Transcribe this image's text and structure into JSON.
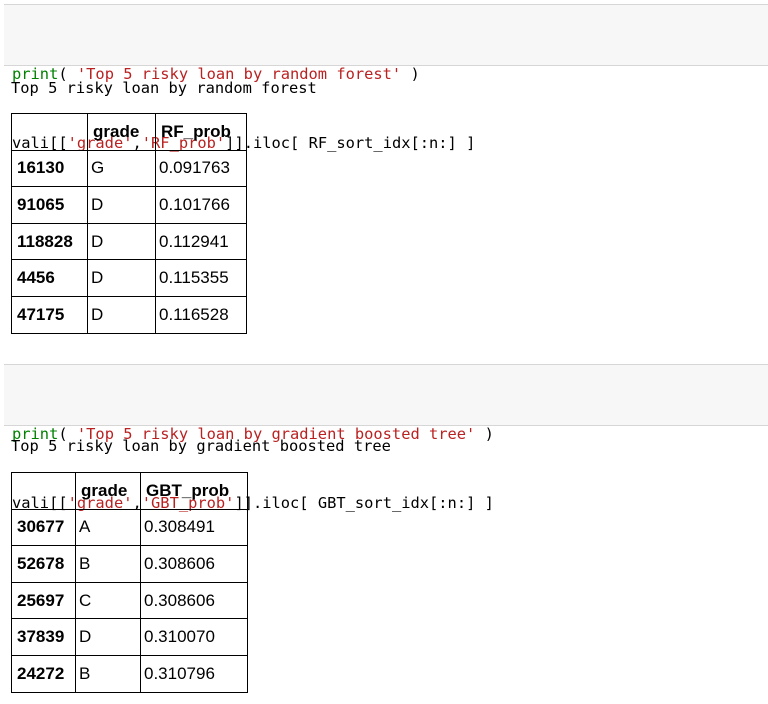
{
  "cell1": {
    "code": {
      "line1": {
        "fn": "print",
        "open": "( ",
        "str": "'Top 5 risky loan by random forest'",
        "close": " )"
      },
      "line2": {
        "pre": "vali[[",
        "s1": "'grade'",
        "comma": ",",
        "s2": "'RF_prob'",
        "post": "]].iloc[ RF_sort_idx[:n:] ]"
      }
    },
    "stdout": "Top 5 risky loan by random forest",
    "table": {
      "columns": [
        "",
        "grade",
        "RF_prob"
      ],
      "rows": [
        {
          "index": "16130",
          "grade": "G",
          "prob": "0.091763"
        },
        {
          "index": "91065",
          "grade": "D",
          "prob": "0.101766"
        },
        {
          "index": "118828",
          "grade": "D",
          "prob": "0.112941"
        },
        {
          "index": "4456",
          "grade": "D",
          "prob": "0.115355"
        },
        {
          "index": "47175",
          "grade": "D",
          "prob": "0.116528"
        }
      ]
    }
  },
  "cell2": {
    "code": {
      "line1": {
        "fn": "print",
        "open": "( ",
        "str": "'Top 5 risky loan by gradient boosted tree'",
        "close": " )"
      },
      "line2": {
        "pre": "vali[[",
        "s1": "'grade'",
        "comma": ",",
        "s2": "'GBT_prob'",
        "post": "]].iloc[ GBT_sort_idx[:n:] ]"
      }
    },
    "stdout": "Top 5 risky loan by gradient boosted tree",
    "table": {
      "columns": [
        "",
        "grade",
        "GBT_prob"
      ],
      "rows": [
        {
          "index": "30677",
          "grade": "A",
          "prob": "0.308491"
        },
        {
          "index": "52678",
          "grade": "B",
          "prob": "0.308606"
        },
        {
          "index": "25697",
          "grade": "C",
          "prob": "0.308606"
        },
        {
          "index": "37839",
          "grade": "D",
          "prob": "0.310070"
        },
        {
          "index": "24272",
          "grade": "B",
          "prob": "0.310796"
        }
      ]
    }
  },
  "colors": {
    "code_bg": "#f7f7f7",
    "keyword": "#008000",
    "string": "#ba2121"
  }
}
